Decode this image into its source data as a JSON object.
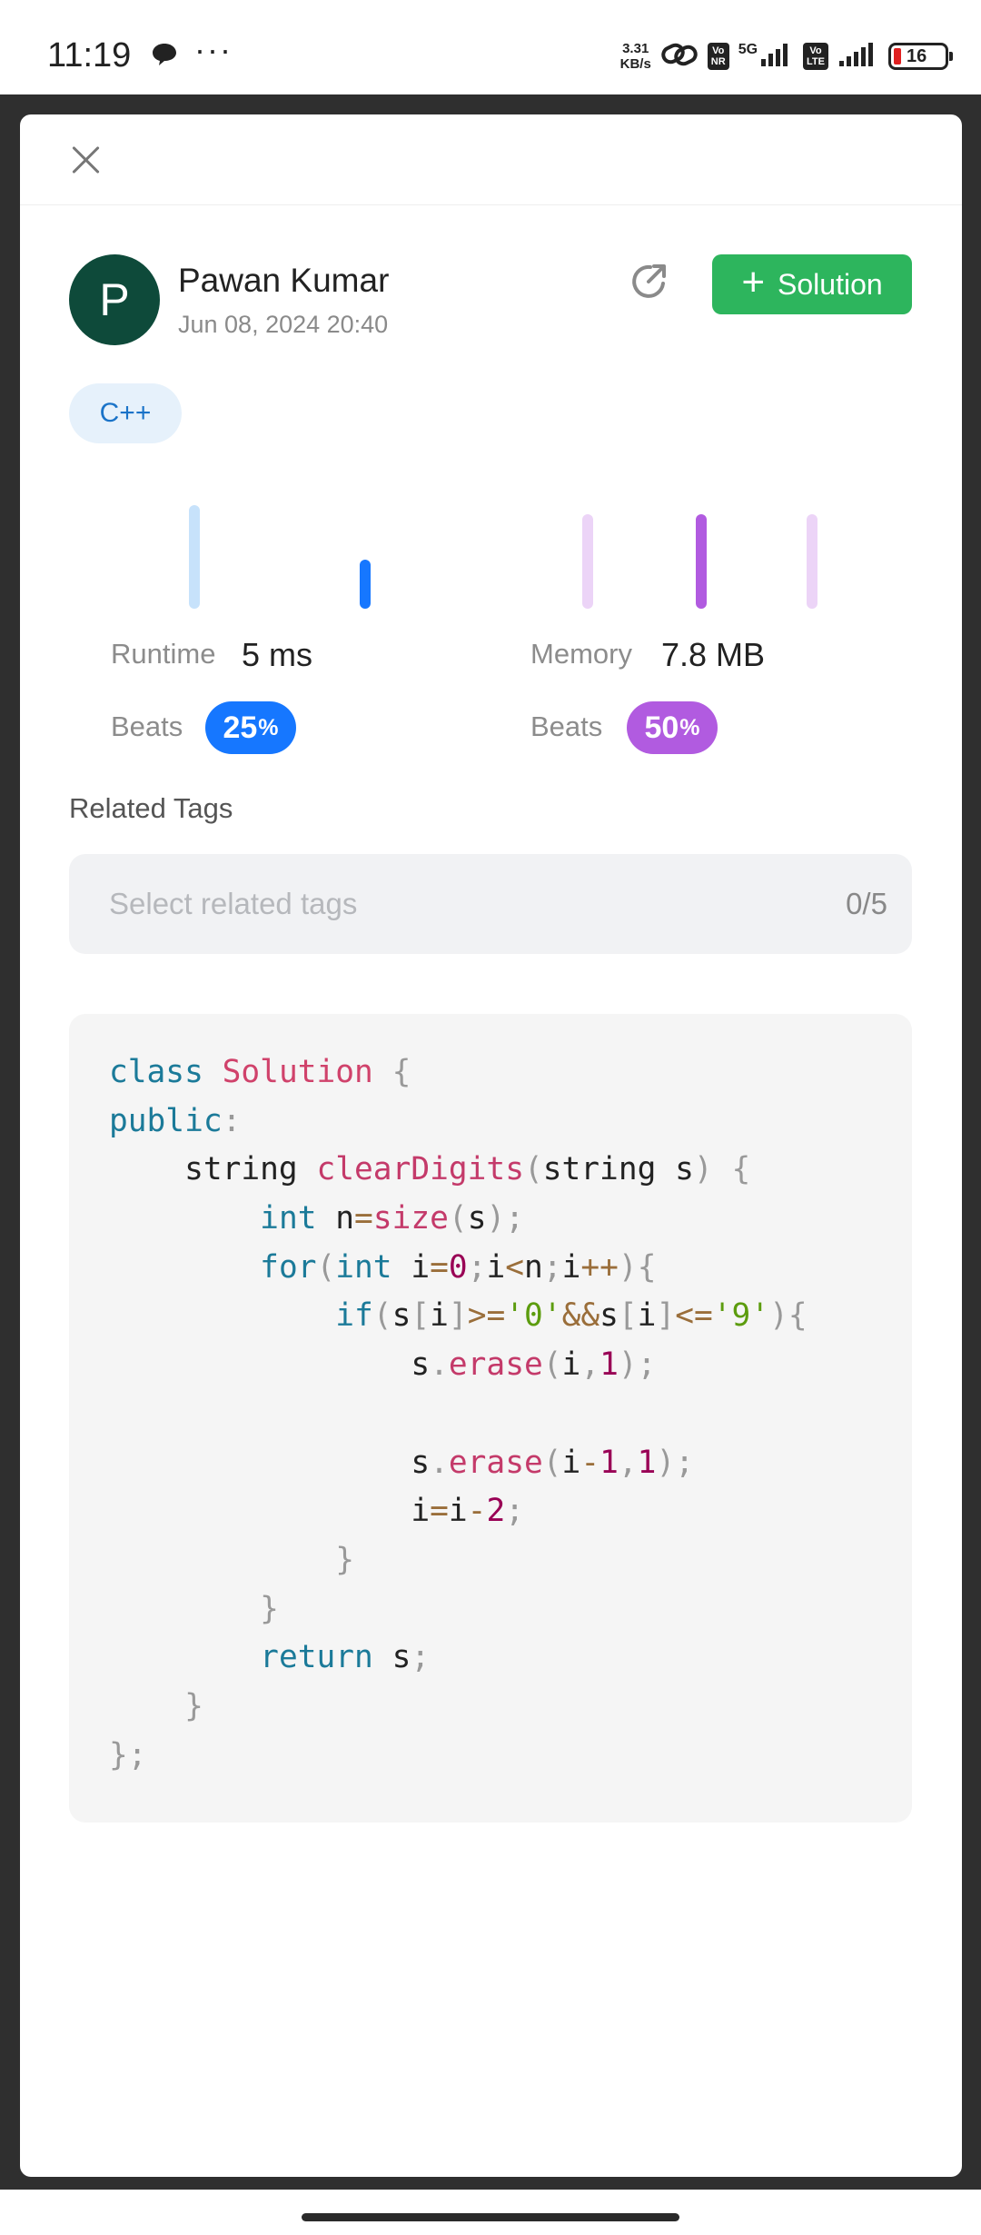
{
  "status_bar": {
    "time": "11:19",
    "dots": "···",
    "net_speed_value": "3.31",
    "net_speed_unit": "KB/s",
    "vonr_label": "Vo\nNR",
    "fiveg_label": "5G",
    "volte_label": "Vo\nLTE",
    "battery_level": "16",
    "battery_color": "#e02020"
  },
  "header": {
    "close_icon": "close-icon"
  },
  "author": {
    "initial": "P",
    "name": "Pawan Kumar",
    "date": "Jun 08, 2024 20:40",
    "avatar_color": "#0e4a3a"
  },
  "actions": {
    "share_icon": "share-arrow-icon",
    "solution_label": "Solution",
    "solution_color": "#2db55d"
  },
  "language_tag": "C++",
  "stats": {
    "runtime": {
      "label": "Runtime",
      "value": "5 ms",
      "beats_label": "Beats",
      "beats_value": "25",
      "beats_unit": "%",
      "color": "#1677ff"
    },
    "memory": {
      "label": "Memory",
      "value": "7.8 MB",
      "beats_label": "Beats",
      "beats_value": "50",
      "beats_unit": "%",
      "color": "#b15be0"
    }
  },
  "related_tags": {
    "title": "Related Tags",
    "placeholder": "Select related tags",
    "count": "0/5"
  },
  "code": {
    "language": "C++",
    "lines": [
      "class Solution {",
      "public:",
      "    string clearDigits(string s) {",
      "        int n=size(s);",
      "        for(int i=0;i<n;i++){",
      "            if(s[i]>='0'&&s[i]<='9'){",
      "                s.erase(i,1);",
      "",
      "                s.erase(i-1,1);",
      "                i=i-2;",
      "            }",
      "        }",
      "        return s;",
      "    }",
      "};"
    ]
  }
}
